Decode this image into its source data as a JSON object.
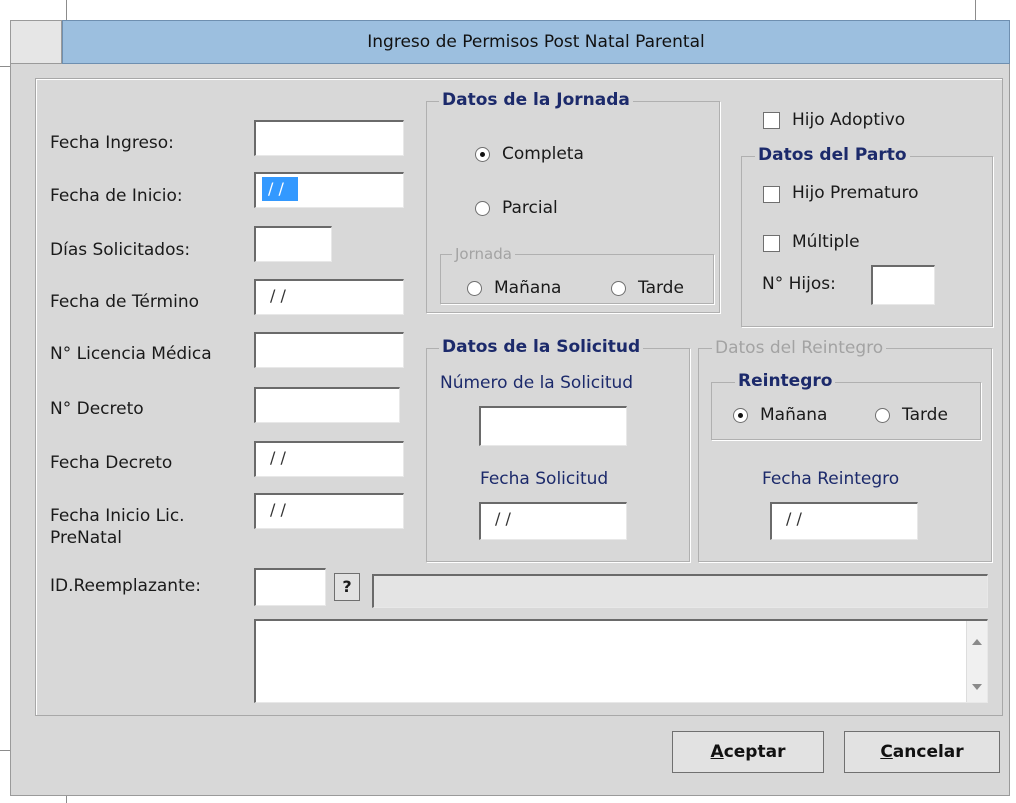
{
  "window": {
    "title": "Ingreso de Permisos Post Natal Parental"
  },
  "fields": [
    {
      "label": "Fecha Ingreso:",
      "value": ""
    },
    {
      "label": "Fecha de Inicio:",
      "value": "/ /"
    },
    {
      "label": "Días Solicitados:",
      "value": ""
    },
    {
      "label": "Fecha de Término",
      "value": "/ /"
    },
    {
      "label": "N° Licencia Médica",
      "value": ""
    },
    {
      "label": "N° Decreto",
      "value": ""
    },
    {
      "label": "Fecha Decreto",
      "value": "/ /"
    },
    {
      "label": "Fecha Inicio Lic. PreNatal",
      "value": "/ /"
    }
  ],
  "reemplazante": {
    "label": "ID.Reemplazante:",
    "id_value": "",
    "lookup_label": "?",
    "name_value": ""
  },
  "jornada_group": {
    "title": "Datos de la Jornada",
    "options": [
      {
        "label": "Completa",
        "selected": true
      },
      {
        "label": "Parcial",
        "selected": false
      }
    ],
    "sub": {
      "title": "Jornada",
      "options": [
        {
          "label": "Mañana",
          "selected": false
        },
        {
          "label": "Tarde",
          "selected": false
        }
      ]
    }
  },
  "hijo_adoptivo": {
    "label": "Hijo Adoptivo",
    "checked": false
  },
  "parto_group": {
    "title": "Datos del Parto",
    "prematuro": {
      "label": "Hijo Prematuro",
      "checked": false
    },
    "multiple": {
      "label": "Múltiple",
      "checked": false
    },
    "hijos": {
      "label": "N° Hijos:",
      "value": ""
    }
  },
  "solicitud_group": {
    "title": "Datos de la Solicitud",
    "numero_label": "Número de la Solicitud",
    "numero_value": "",
    "fecha_label": "Fecha Solicitud",
    "fecha_value": "/ /"
  },
  "reintegro_group": {
    "title": "Datos del Reintegro",
    "sub": {
      "title": "Reintegro",
      "options": [
        {
          "label": "Mañana",
          "selected": true
        },
        {
          "label": "Tarde",
          "selected": false
        }
      ]
    },
    "fecha_label": "Fecha Reintegro",
    "fecha_value": "/ /"
  },
  "buttons": {
    "accept_prefix": "A",
    "accept_rest": "ceptar",
    "cancel_prefix": "C",
    "cancel_rest": "ancelar"
  },
  "colors": {
    "title_bar": "#9cbfdf",
    "group_title": "#1c2a6b",
    "selection": "#3399ff"
  }
}
